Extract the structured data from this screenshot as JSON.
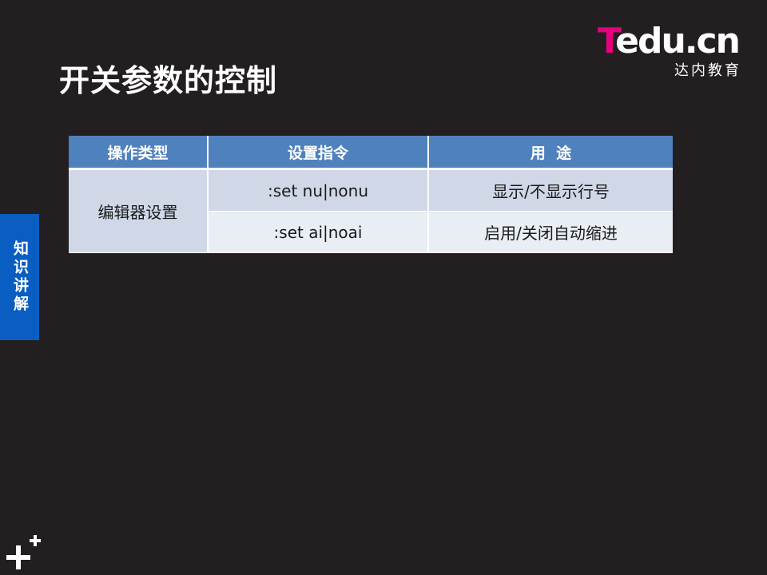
{
  "slide": {
    "title": "开关参数的控制"
  },
  "logo": {
    "brand_t": "T",
    "brand_rest": "edu.cn",
    "subtitle": "达内教育",
    "brand_color": "#e6007e"
  },
  "side_tab": {
    "label": "知识讲解",
    "color": "#0a5ec2"
  },
  "table": {
    "headers": [
      "操作类型",
      "设置指令",
      "用  途"
    ],
    "group": "编辑器设置",
    "rows": [
      {
        "command": ":set nu|nonu",
        "purpose": "显示/不显示行号"
      },
      {
        "command": ":set ai|noai",
        "purpose": "启用/关闭自动缩进"
      }
    ],
    "header_color": "#4f81bd"
  },
  "decoration": {
    "corner_icon": "plus-icon"
  }
}
